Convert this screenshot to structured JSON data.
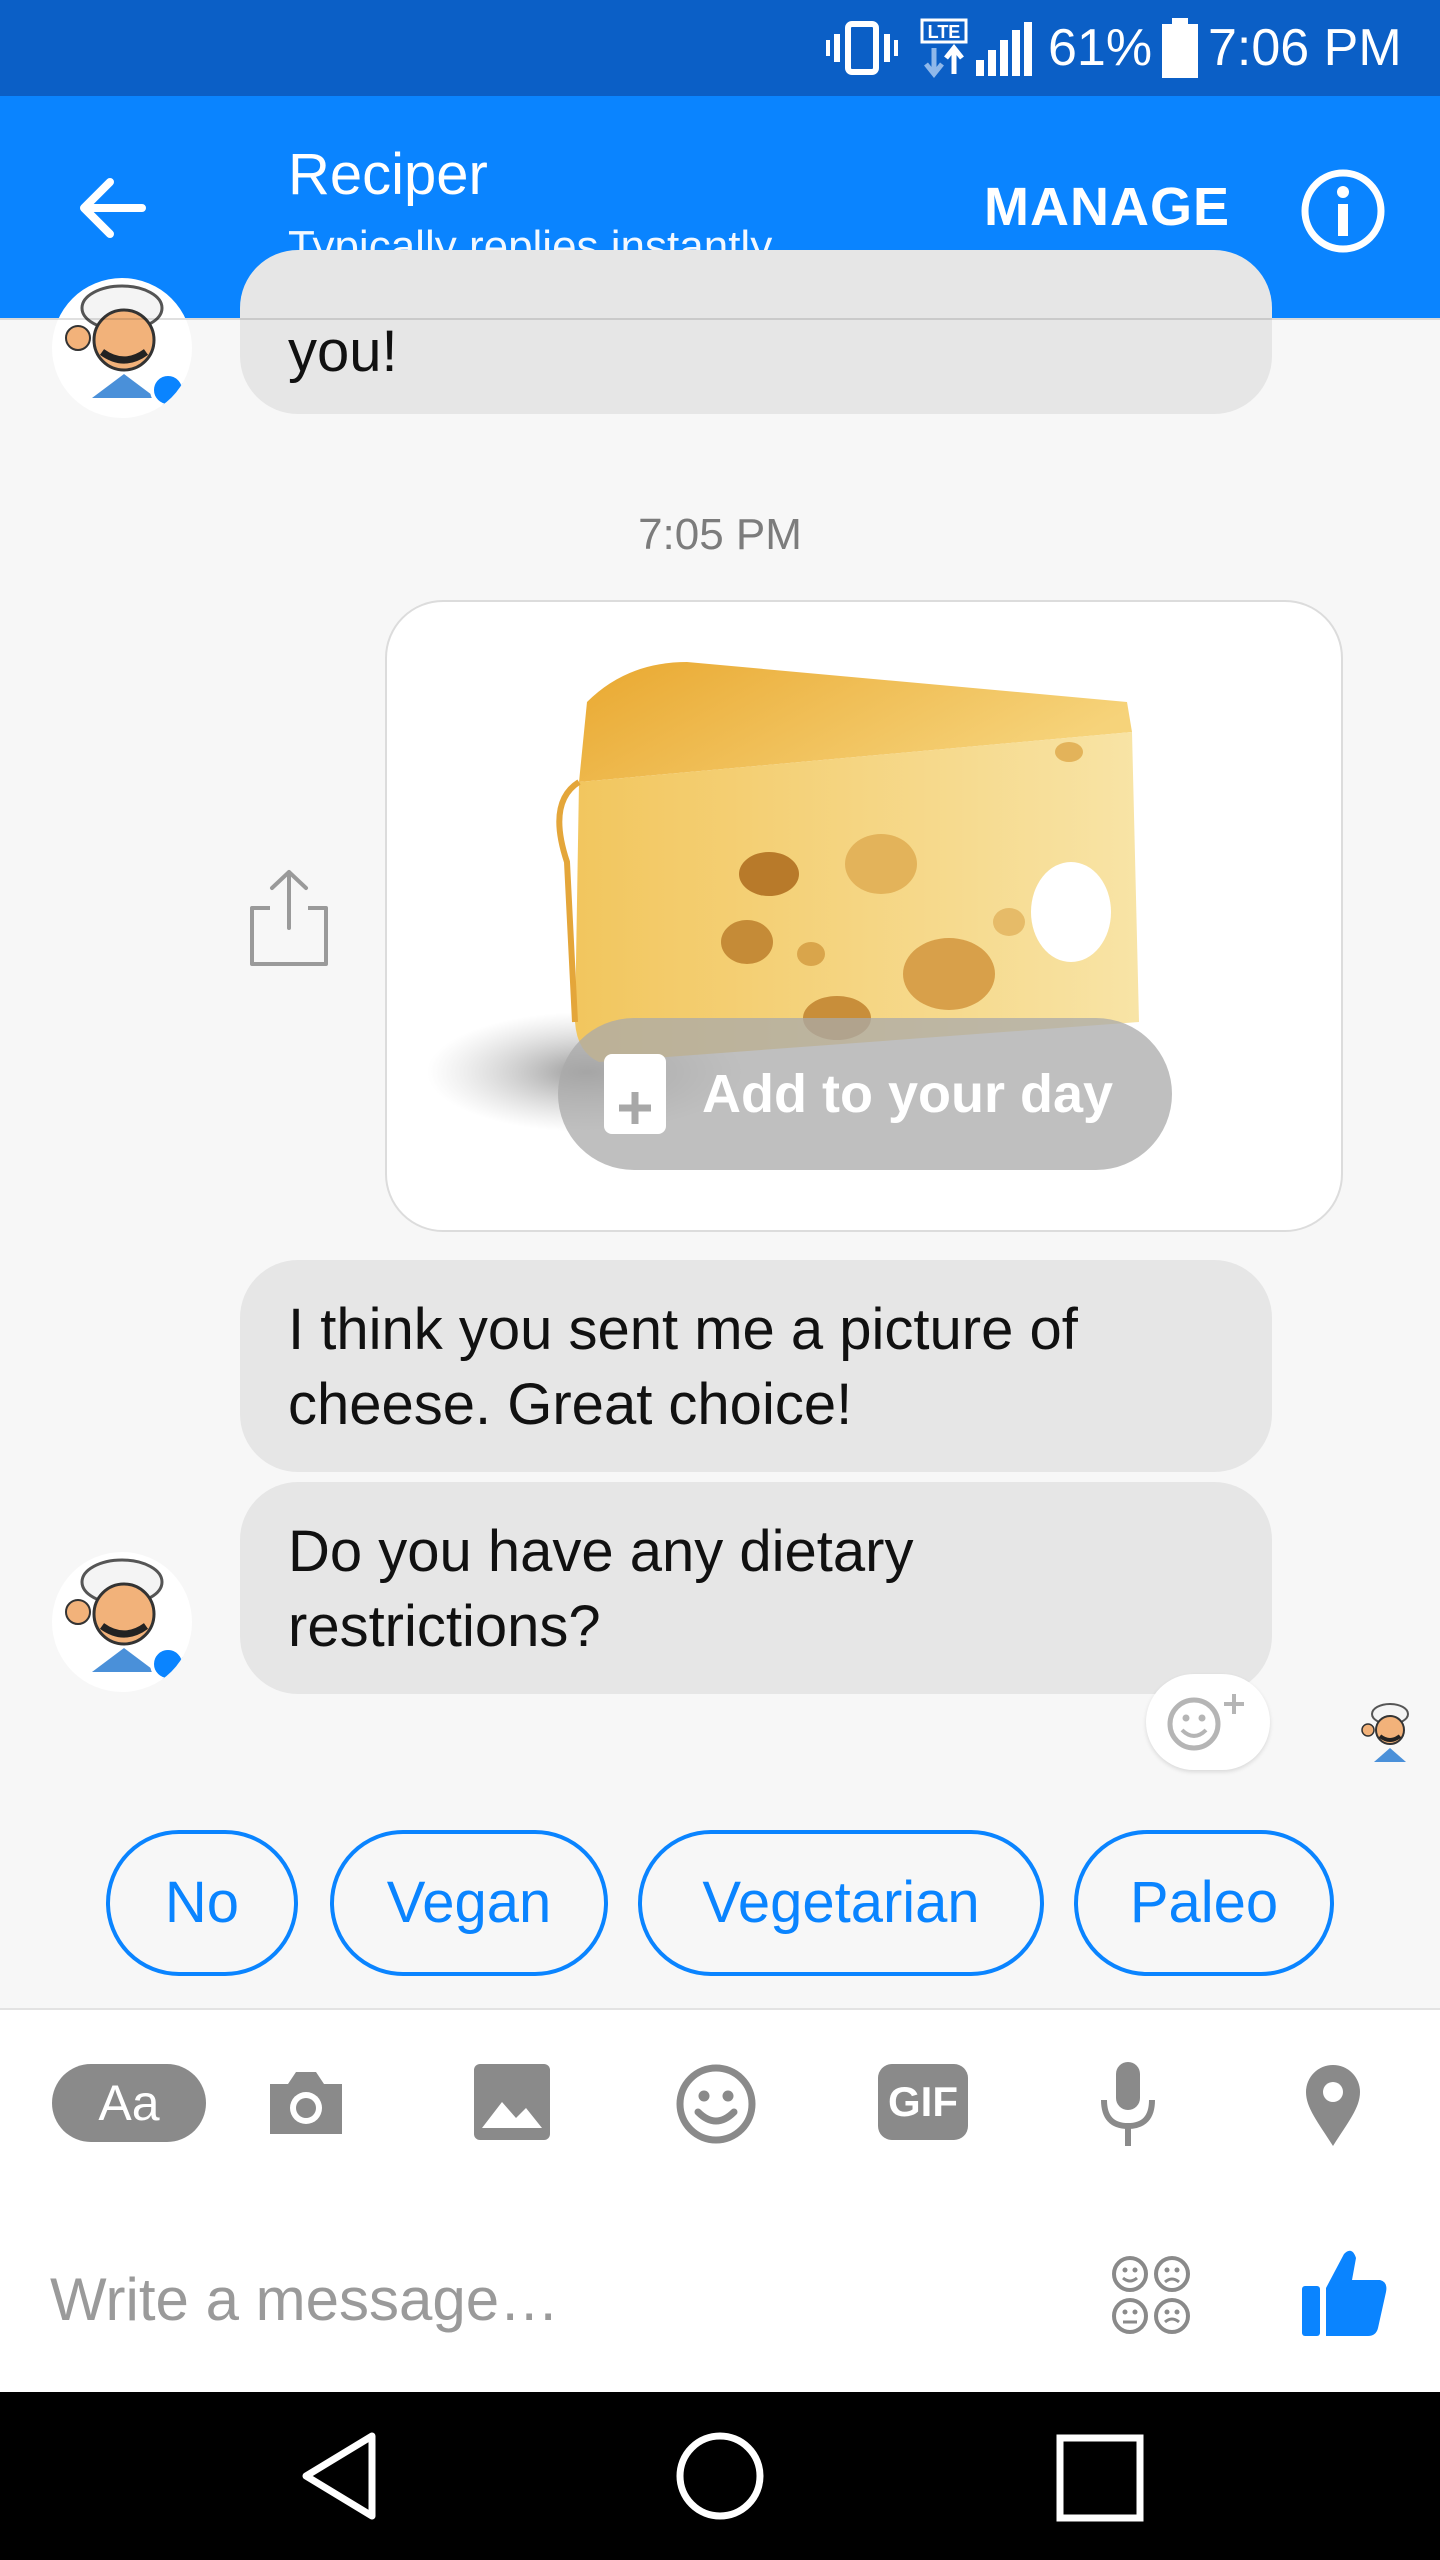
{
  "status_bar": {
    "battery_percent": "61%",
    "time": "7:06 PM",
    "network": "LTE"
  },
  "header": {
    "title": "Reciper",
    "subtitle": "Typically replies instantly",
    "manage_label": "MANAGE"
  },
  "conversation": {
    "previous_message_tail": "you!",
    "timestamp": "7:05 PM",
    "card": {
      "action_label": "Add to your day"
    },
    "messages": [
      "I think you sent me a picture of cheese. Great choice!",
      "Do you have any dietary restrictions?"
    ]
  },
  "quick_replies": [
    "No",
    "Vegan",
    "Vegetarian",
    "Paleo"
  ],
  "composer": {
    "placeholder": "Write a message…",
    "text_button_label": "Aa",
    "gif_label": "GIF"
  },
  "colors": {
    "brand_blue": "#0a84ff",
    "status_bar_blue": "#0b5fc6",
    "bubble_gray": "#e6e6e6",
    "icon_gray": "#8a8a8a"
  }
}
